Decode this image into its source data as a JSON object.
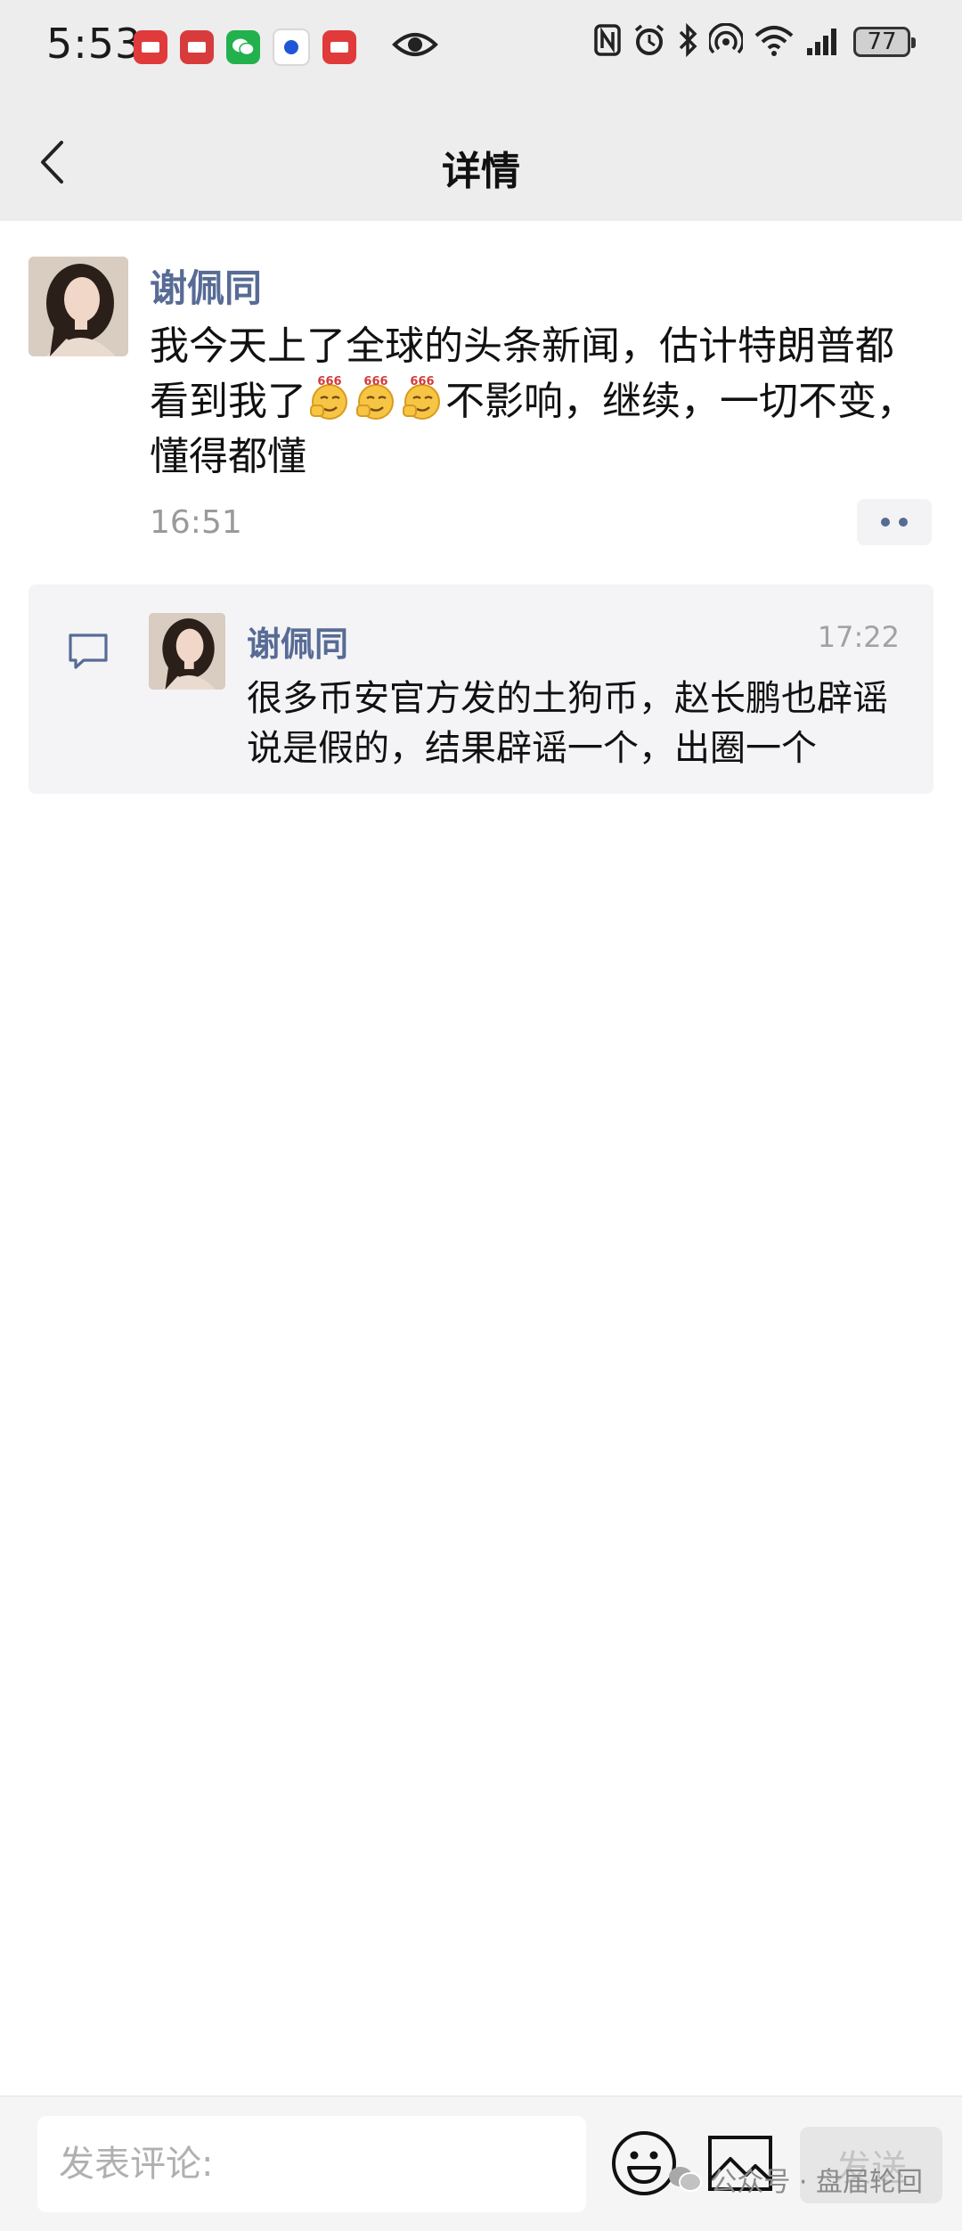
{
  "status_bar": {
    "time": "5:53",
    "battery": "77"
  },
  "header": {
    "title": "详情"
  },
  "post": {
    "author": "谢佩同",
    "text_part1": "我今天上了全球的头条新闻，估计特朗普都看到我了",
    "emojis": [
      "smirk-666-emoji",
      "smirk-666-emoji",
      "smirk-666-emoji"
    ],
    "emoji_label": "666",
    "text_part2": "不影响，继续，一切不变，懂得都懂",
    "time": "16:51"
  },
  "comments": [
    {
      "author": "谢佩同",
      "time": "17:22",
      "text": "很多币安官方发的土狗币，赵长鹏也辟谣说是假的，结果辟谣一个，出圈一个"
    }
  ],
  "comment_bar": {
    "placeholder": "发表评论:",
    "send_label": "发送"
  },
  "watermark": {
    "text": "公众号 · 盘届轮回"
  },
  "colors": {
    "link_name": "#576b95",
    "header_bg": "#ededed",
    "comment_bg": "#f4f4f6"
  }
}
